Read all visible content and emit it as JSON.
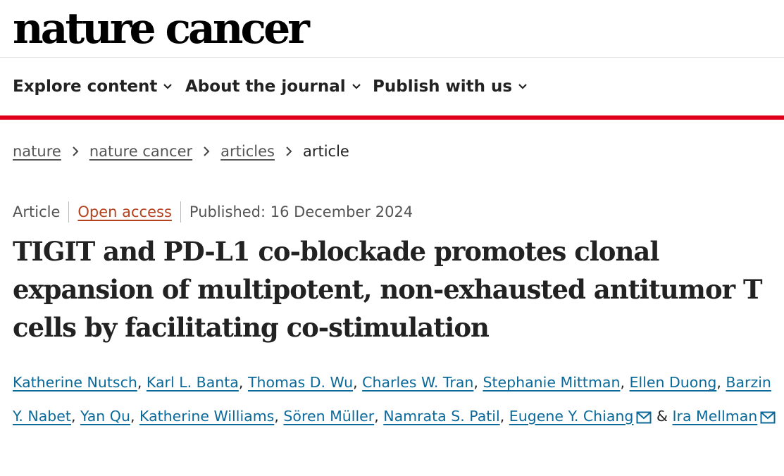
{
  "masthead": {
    "logo": "nature cancer"
  },
  "nav": {
    "items": [
      {
        "label": "Explore content"
      },
      {
        "label": "About the journal"
      },
      {
        "label": "Publish with us"
      }
    ]
  },
  "breadcrumb": {
    "items": [
      {
        "label": "nature"
      },
      {
        "label": "nature cancer"
      },
      {
        "label": "articles"
      }
    ],
    "current": "article"
  },
  "article": {
    "type": "Article",
    "access": "Open access",
    "published": "Published: 16 December 2024",
    "title": "TIGIT and PD-L1 co-blockade promotes clonal expansion of multipotent, non-exhausted antitumor T cells by facilitating co-stimulation",
    "authors": [
      "Katherine Nutsch",
      "Karl L. Banta",
      "Thomas D. Wu",
      "Charles W. Tran",
      "Stephanie Mittman",
      "Ellen Duong",
      "Barzin Y. Nabet",
      "Yan Qu",
      "Katherine Williams",
      "Sören Müller",
      "Namrata S. Patil",
      "Eugene Y. Chiang",
      "Ira Mellman"
    ],
    "author_separator": ",",
    "last_separator": "&"
  },
  "colors": {
    "accent_red": "#e0001b",
    "link_blue": "#0b6a9a",
    "open_access": "#b5421e"
  }
}
